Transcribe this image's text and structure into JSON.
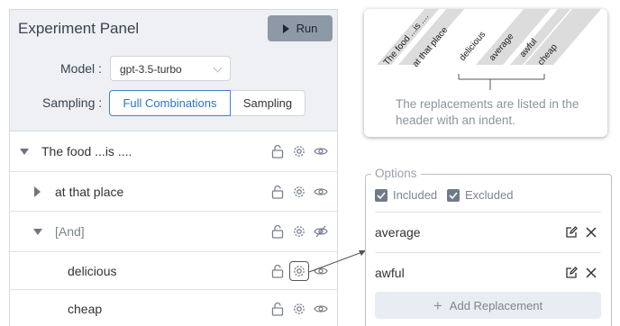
{
  "panel": {
    "title": "Experiment Panel",
    "run_label": "Run",
    "model_label": "Model :",
    "model_value": "gpt-3.5-turbo",
    "sampling_label": "Sampling :",
    "sampling_options": [
      "Full Combinations",
      "Sampling"
    ],
    "sampling_selected": "Full Combinations"
  },
  "tree": [
    {
      "label": "The food ...is ....",
      "state": "expanded",
      "visibility": "visible"
    },
    {
      "label": "at that place",
      "state": "collapsed",
      "visibility": "visible"
    },
    {
      "label": "[And]",
      "state": "expanded",
      "visibility": "hidden"
    },
    {
      "label": "delicious",
      "state": "leaf",
      "visibility": "visible"
    },
    {
      "label": "cheap",
      "state": "leaf",
      "visibility": "visible"
    }
  ],
  "callout": {
    "headers": [
      "The food ...is ....",
      "at that place",
      "delicious",
      "average",
      "awful",
      "cheap"
    ],
    "text": "The replacements are listed in the header with an indent."
  },
  "options": {
    "legend": "Options",
    "included_label": "Included",
    "excluded_label": "Excluded",
    "included_checked": true,
    "excluded_checked": true,
    "replacements": [
      "average",
      "awful"
    ],
    "add_label": "Add Replacement"
  }
}
